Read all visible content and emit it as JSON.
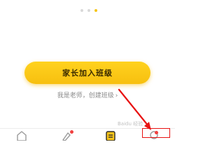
{
  "pager": {
    "count": 3,
    "active": 3
  },
  "main": {
    "join_button_label": "家长加入班级",
    "teacher_link": "我是老师，创建班级",
    "teacher_chevron": "›"
  },
  "tabbar": {
    "tabs": [
      {
        "icon": "home-icon"
      },
      {
        "icon": "bookmark-icon",
        "badge": true
      },
      {
        "icon": "notebook-icon"
      },
      {
        "icon": "profile-icon",
        "badge": true
      }
    ]
  },
  "annotation": {
    "color": "#e81212"
  },
  "watermark": "Baidu 经验",
  "colors": {
    "accent": "#f7c31a",
    "badge": "#f04140"
  }
}
